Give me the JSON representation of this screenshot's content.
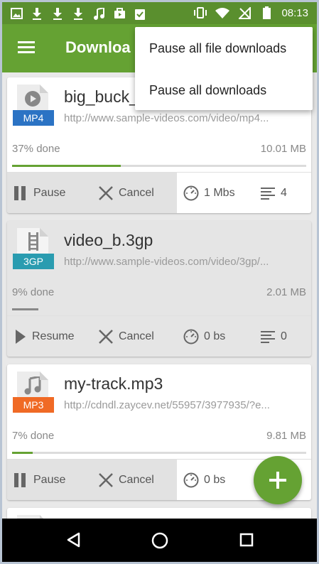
{
  "statusbar": {
    "time": "08:13",
    "left_icons": [
      "image-icon",
      "download-icon",
      "download-icon",
      "download-icon",
      "music-icon",
      "briefcase-icon",
      "clipboard-check-icon"
    ],
    "right_icons": [
      "vibrate-icon",
      "wifi-icon",
      "no-signal-icon",
      "battery-icon"
    ]
  },
  "appbar": {
    "title": "Downloa"
  },
  "menu": {
    "items": [
      "Pause all file downloads",
      "Pause all downloads"
    ]
  },
  "downloads": [
    {
      "name": "big_buck_",
      "type": "MP4",
      "url": "http://www.sample-videos.com/video/mp4...",
      "progress_text": "37% done",
      "progress": 0.37,
      "size": "10.01 MB",
      "action_label": "Pause",
      "cancel_label": "Cancel",
      "speed": "1 Mbs",
      "connections": "4",
      "color": "#2b73c4"
    },
    {
      "name": "video_b.3gp",
      "type": "3GP",
      "url": "http://www.sample-videos.com/video/3gp/...",
      "progress_text": "9% done",
      "progress": 0.09,
      "size": "2.01 MB",
      "action_label": "Resume",
      "cancel_label": "Cancel",
      "speed": "0 bs",
      "connections": "0",
      "color": "#2a9cb0"
    },
    {
      "name": "my-track.mp3",
      "type": "MP3",
      "url": "http://cdndl.zaycev.net/55957/3977935/?e...",
      "progress_text": "7% done",
      "progress": 0.07,
      "size": "9.81 MB",
      "action_label": "Pause",
      "cancel_label": "Cancel",
      "speed": "0 bs",
      "connections": "",
      "color": "#f06a25"
    },
    {
      "name": "fi",
      "type": "",
      "url": "",
      "progress_text": "",
      "size": ""
    }
  ],
  "fab": {
    "label": "+"
  },
  "navbar": {
    "icons": [
      "back-icon",
      "home-icon",
      "recents-icon"
    ]
  },
  "colors": {
    "primary": "#65a233",
    "statusbar": "#5a8f2e"
  }
}
